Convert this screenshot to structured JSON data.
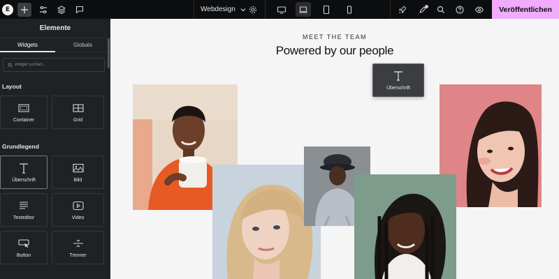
{
  "topbar": {
    "site_name": "Webdesign",
    "publish_label": "Veröffentlichen",
    "icons": [
      "elementor-logo-icon",
      "add-icon",
      "settings-sliders-icon",
      "layers-icon",
      "comments-icon",
      "site-settings-icon",
      "desktop-icon",
      "laptop-icon",
      "tablet-icon",
      "mobile-icon",
      "rocket-icon",
      "notes-icon",
      "search-icon",
      "help-icon",
      "preview-eye-icon"
    ],
    "active_device": "laptop",
    "accent_color": "#f0abfc"
  },
  "panel": {
    "title": "Elemente",
    "tabs": [
      {
        "label": "Widgets",
        "active": true
      },
      {
        "label": "Globals",
        "active": false
      }
    ],
    "search_placeholder": "Widget suchen...",
    "sections": [
      {
        "title": "Layout",
        "widgets": [
          {
            "label": "Container",
            "icon": "container-icon"
          },
          {
            "label": "Grid",
            "icon": "grid-icon"
          }
        ]
      },
      {
        "title": "Grundlegend",
        "widgets": [
          {
            "label": "Überschrift",
            "icon": "heading-icon",
            "selected": true
          },
          {
            "label": "Bild",
            "icon": "image-icon"
          },
          {
            "label": "Texteditor",
            "icon": "text-editor-icon"
          },
          {
            "label": "Video",
            "icon": "video-icon"
          },
          {
            "label": "Button",
            "icon": "button-icon"
          },
          {
            "label": "Trenner",
            "icon": "divider-icon"
          }
        ]
      }
    ]
  },
  "canvas": {
    "eyebrow": "MEET THE TEAM",
    "headline": "Powered by our people",
    "drag_widget_label": "Überschrift",
    "photos": [
      "team-member-orange-sweater",
      "team-member-blonde",
      "team-member-bucket-hat",
      "team-member-braids",
      "team-member-pink-background"
    ]
  }
}
